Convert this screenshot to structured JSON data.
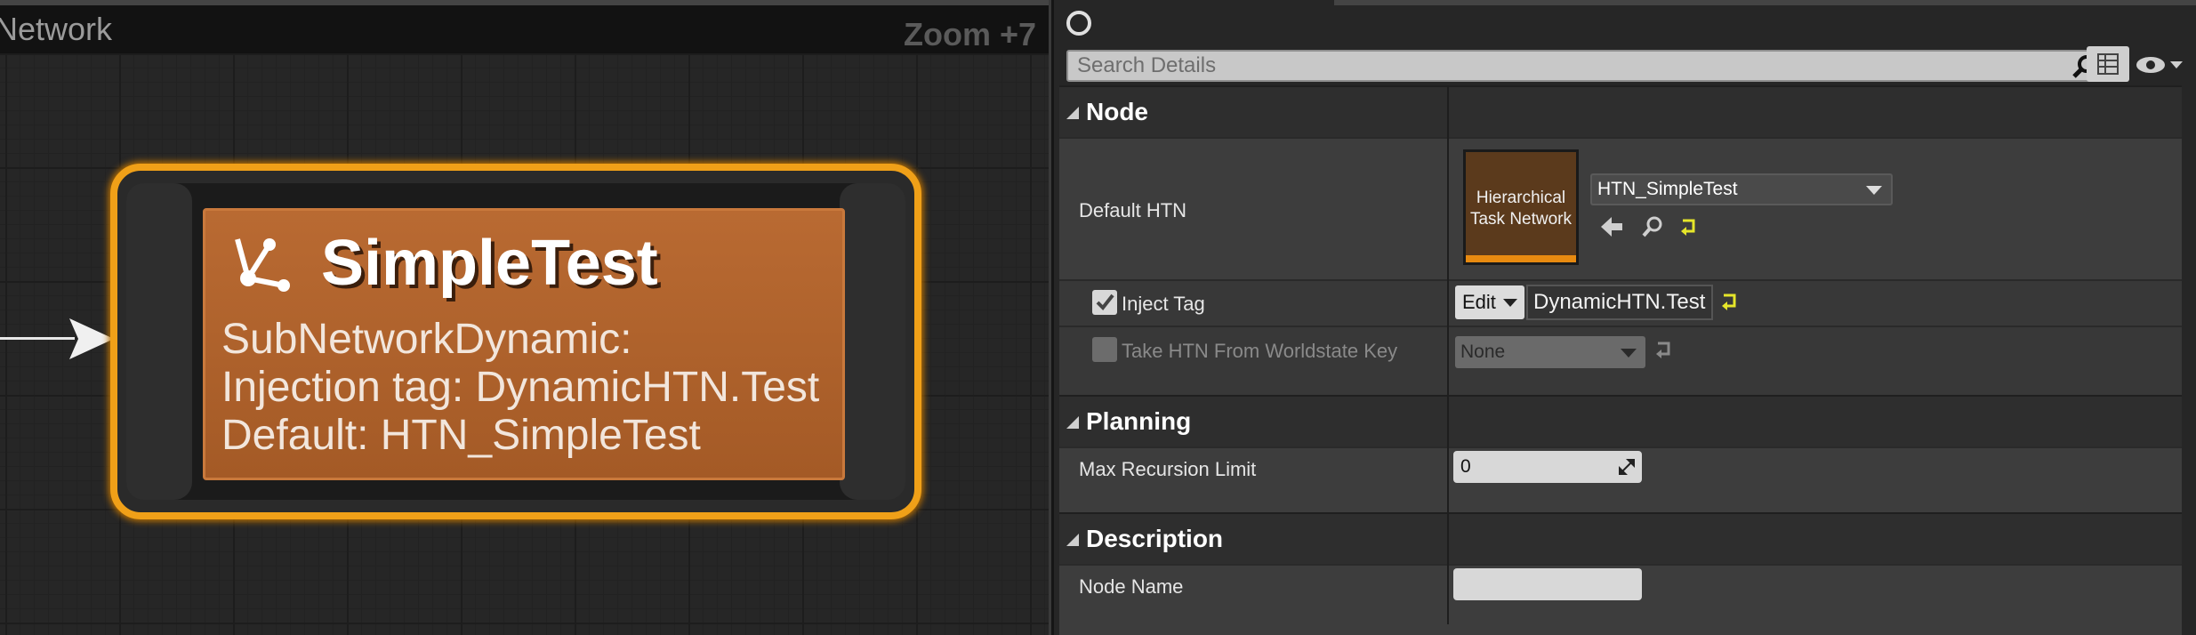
{
  "graph": {
    "title": "Network",
    "zoom": "Zoom +7",
    "node": {
      "title": "SimpleTest",
      "description": "SubNetworkDynamic:\nInjection tag: DynamicHTN.Test\nDefault: HTN_SimpleTest"
    }
  },
  "details": {
    "search_placeholder": "Search Details",
    "sections": {
      "node": "Node",
      "planning": "Planning",
      "description": "Description"
    },
    "rows": {
      "default_htn": {
        "label": "Default HTN",
        "thumbnail": "Hierarchical Task Network",
        "asset": "HTN_SimpleTest"
      },
      "inject_tag": {
        "label": "Inject Tag",
        "checked": true,
        "edit": "Edit",
        "value": "DynamicHTN.Test"
      },
      "take_htn": {
        "label": "Take HTN From Worldstate Key",
        "checked": false,
        "value": "None"
      },
      "max_recursion": {
        "label": "Max Recursion Limit",
        "value": "0"
      },
      "node_name": {
        "label": "Node Name",
        "value": ""
      }
    }
  },
  "colors": {
    "node_accent": "#f0a018",
    "node_body": "#b96a32",
    "reset_arrow": "#e6e62a"
  }
}
